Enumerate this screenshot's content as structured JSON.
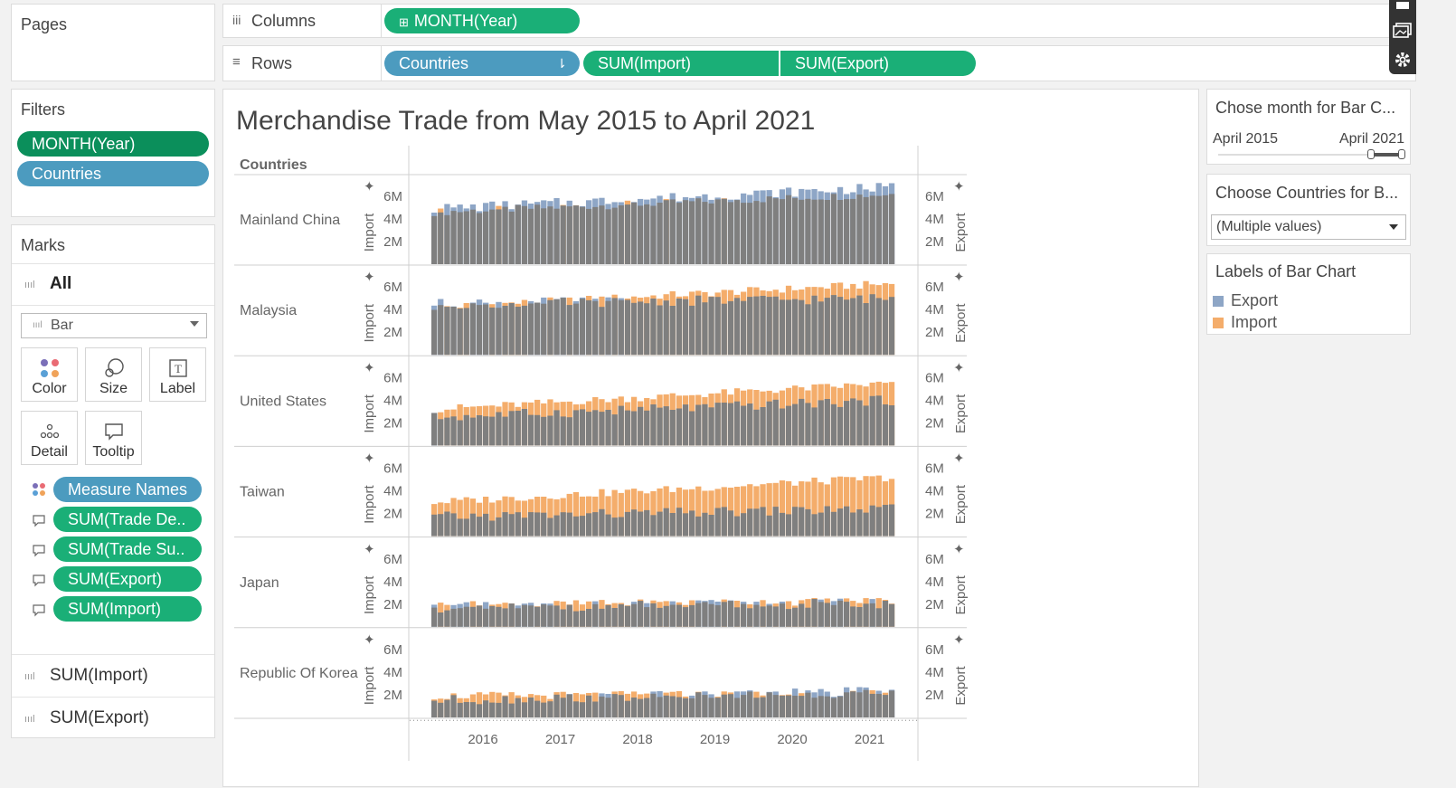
{
  "shelves": {
    "pages": "Pages",
    "columns_label": "Columns",
    "rows_label": "Rows",
    "columns_pills": [
      "MONTH(Year)"
    ],
    "rows_pills": [
      "Countries",
      "SUM(Import)",
      "SUM(Export)"
    ]
  },
  "filters": {
    "title": "Filters",
    "items": [
      "MONTH(Year)",
      "Countries"
    ]
  },
  "marks": {
    "title": "Marks",
    "all_label": "All",
    "mark_type": "Bar",
    "cards": [
      "Color",
      "Size",
      "Label",
      "Detail",
      "Tooltip"
    ],
    "fields": [
      "Measure Names",
      "SUM(Trade De..",
      "SUM(Trade Su..",
      "SUM(Export)",
      "SUM(Import)"
    ],
    "sub_tabs": [
      "SUM(Import)",
      "SUM(Export)"
    ]
  },
  "right_panel": {
    "month_filter_title": "Chose month for Bar C...",
    "range_start": "April 2015",
    "range_end": "April 2021",
    "country_filter_title": "Choose Countries for B...",
    "country_value": "(Multiple values)",
    "legend_title": "Labels of Bar Chart",
    "legend_items": [
      {
        "label": "Export",
        "color": "#8ea6c6"
      },
      {
        "label": "Import",
        "color": "#f4ad6b"
      }
    ]
  },
  "chart_data": {
    "type": "bar",
    "title": "Merchandise Trade from May 2015 to April 2021",
    "row_header": "Countries",
    "left_axis_label": "Import",
    "right_axis_label": "Export",
    "y_ticks": [
      "6M",
      "4M",
      "2M"
    ],
    "ylim": [
      0,
      7000000
    ],
    "x_ticks": [
      "2016",
      "2017",
      "2018",
      "2019",
      "2020",
      "2021"
    ],
    "months": 72,
    "colors": {
      "export": "#8ea6c6",
      "import": "#f4ad6b",
      "overlap": "#7f7f7f"
    },
    "series": [
      {
        "name": "Mainland China",
        "import_start": 4.6,
        "import_end": 6.2,
        "export_start": 4.9,
        "export_end": 6.8
      },
      {
        "name": "Malaysia",
        "import_start": 4.2,
        "import_end": 6.3,
        "export_start": 4.5,
        "export_end": 5.0
      },
      {
        "name": "United States",
        "import_start": 3.2,
        "import_end": 5.5,
        "export_start": 2.5,
        "export_end": 4.0
      },
      {
        "name": "Taiwan",
        "import_start": 3.0,
        "import_end": 5.2,
        "export_start": 1.7,
        "export_end": 2.4
      },
      {
        "name": "Japan",
        "import_start": 1.9,
        "import_end": 2.3,
        "export_start": 1.7,
        "export_end": 2.1
      },
      {
        "name": "Republic Of Korea",
        "import_start": 1.9,
        "import_end": 2.1,
        "export_start": 1.5,
        "export_end": 2.3
      }
    ]
  }
}
